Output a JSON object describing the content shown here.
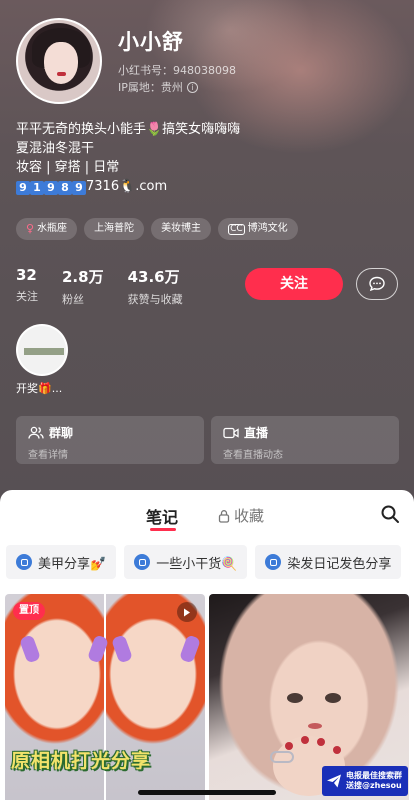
{
  "profile": {
    "username": "小小舒",
    "rednote_id": "小红书号：948038098",
    "ip_location": "IP属地：贵州",
    "info_glyph": "i",
    "bio_line1": "平平无奇的换头小能手🌷搞笑女嗨嗨嗨",
    "bio_line2": "夏混油冬混干",
    "bio_line3": "妆容 | 穿搭 | 日常",
    "bio_contact_digits": [
      "9",
      "1",
      "9",
      "8",
      "9"
    ],
    "bio_contact_tail": "7316🐧.com"
  },
  "tags": [
    "水瓶座",
    "上海普陀",
    "美妆博主",
    "博鸿文化"
  ],
  "tag_icons": {
    "female": "♀",
    "company": "CC"
  },
  "stats": [
    {
      "value": "32",
      "label": "关注"
    },
    {
      "value": "2.8万",
      "label": "粉丝"
    },
    {
      "value": "43.6万",
      "label": "获赞与收藏"
    }
  ],
  "actions": {
    "follow_label": "关注"
  },
  "highlight": {
    "label": "开奖🎁..."
  },
  "cards": [
    {
      "title": "群聊",
      "subtitle": "查看详情"
    },
    {
      "title": "直播",
      "subtitle": "查看直播动态"
    }
  ],
  "tabs": {
    "notes": "笔记",
    "favorites": "收藏"
  },
  "collections": [
    "美甲分享💅",
    "一些小干货🍭",
    "染发日记发色分享"
  ],
  "notes": [
    {
      "pin_label": "置顶",
      "caption": "原相机打光分享"
    }
  ],
  "watermark": {
    "line1": "电报最佳搜索群",
    "line2": "送搜@zhesou"
  },
  "colors": {
    "accent": "#ff2e4d",
    "collection_icon": "#3d7bd8",
    "watermark_bg": "#1a2fb8"
  }
}
